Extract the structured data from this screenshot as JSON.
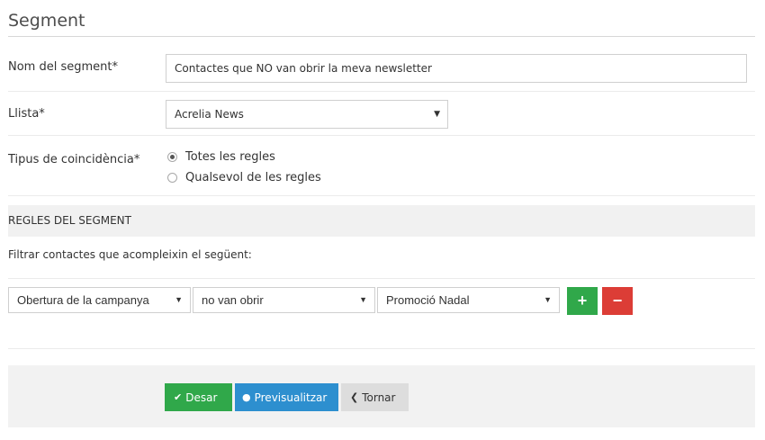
{
  "header": {
    "title": "Segment"
  },
  "form": {
    "name_label": "Nom del segment*",
    "name_value": "Contactes que NO van obrir la meva newsletter",
    "list_label": "Llista*",
    "list_value": "Acrelia News",
    "match_label": "Tipus de coincidència*",
    "match_options": [
      "Totes les regles",
      "Qualsevol de les regles"
    ],
    "match_selected": "Totes les regles"
  },
  "rules": {
    "section_title": "REGLES DEL SEGMENT",
    "filter_text": "Filtrar contactes que acompleixin el següent:",
    "rule": {
      "field": "Obertura de la campanya",
      "condition": "no van obrir",
      "campaign": "Promoció Nadal"
    },
    "add_symbol": "+",
    "remove_symbol": "−"
  },
  "footer": {
    "save_label": "Desar",
    "preview_label": "Previsualitzar",
    "back_label": "Tornar"
  },
  "colors": {
    "save": "#30a84a",
    "preview": "#2d8fcf",
    "back": "#dddddd",
    "add": "#30a84a",
    "remove": "#dc3d36"
  },
  "icons": {
    "select_caret": "caret-down-icon",
    "save": "check-icon",
    "preview": "eye-circle-icon",
    "back": "chevron-left-icon"
  }
}
